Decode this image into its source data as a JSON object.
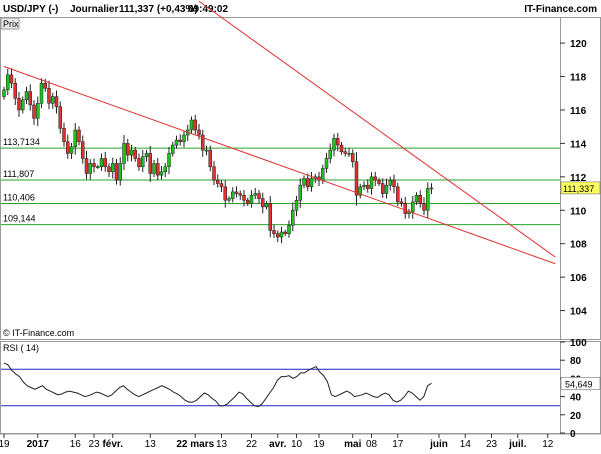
{
  "header": {
    "symbol": "USD/JPY (-)",
    "period": "Journalier",
    "last": "111,337 (+0,43%)",
    "time": "09:49:02",
    "brand": "IT-Finance.com"
  },
  "price_panel": {
    "tab_label": "Prix",
    "watermark": "© IT-Finance.com"
  },
  "rsi_panel": {
    "title": "RSI ( 14)"
  },
  "colors": {
    "up": "#1cc41c",
    "down": "#e03030",
    "wick": "#222222",
    "trendline": "#e03030",
    "hline": "#2aa52a",
    "rsi_line": "#222222",
    "rsi_bounds": "#2020c0",
    "last_price_label_bg": "#ffff60"
  },
  "chart_data": [
    {
      "type": "candlestick",
      "title": "USD/JPY (-)",
      "y_ticks": [
        104,
        106,
        108,
        110,
        112,
        114,
        116,
        118,
        120
      ],
      "ylim": [
        102.3,
        121.5
      ],
      "x_tick_labels": [
        {
          "label": "19",
          "bar": 0
        },
        {
          "label": "2017",
          "bar": 9
        },
        {
          "label": "16",
          "bar": 19
        },
        {
          "label": "23",
          "bar": 24
        },
        {
          "label": "févr.",
          "bar": 29
        },
        {
          "label": "13",
          "bar": 39
        },
        {
          "label": "22 mars",
          "bar": 51
        },
        {
          "label": "13",
          "bar": 58
        },
        {
          "label": "22",
          "bar": 66
        },
        {
          "label": "avr.",
          "bar": 73
        },
        {
          "label": "10",
          "bar": 78
        },
        {
          "label": "19",
          "bar": 84
        },
        {
          "label": "mai",
          "bar": 93
        },
        {
          "label": "08",
          "bar": 98
        },
        {
          "label": "17",
          "bar": 105
        },
        {
          "label": "juin",
          "bar": 116
        },
        {
          "label": "14",
          "bar": 123
        },
        {
          "label": "23",
          "bar": 130
        },
        {
          "label": "juil.",
          "bar": 137
        },
        {
          "label": "12",
          "bar": 145
        }
      ],
      "last_price": 111.337,
      "last_price_label": "111,337",
      "horizontal_levels": [
        {
          "value": 113.7134,
          "label": "113,7134"
        },
        {
          "value": 111.807,
          "label": "111,807"
        },
        {
          "value": 110.406,
          "label": "110,406"
        },
        {
          "value": 109.144,
          "label": "109,144"
        }
      ],
      "trendlines": [
        {
          "from": {
            "bar": 0,
            "price": 118.6
          },
          "to": {
            "bar": 147,
            "price": 106.8
          }
        },
        {
          "from": {
            "bar": 52,
            "price": 122.5
          },
          "to": {
            "bar": 147,
            "price": 107.2
          }
        }
      ],
      "closes": [
        117.2,
        118.1,
        117.6,
        116.7,
        116.0,
        116.6,
        117.1,
        116.3,
        115.5,
        116.4,
        117.6,
        117.3,
        116.4,
        116.8,
        116.2,
        114.9,
        114.1,
        113.4,
        113.8,
        114.8,
        114.1,
        113.1,
        112.2,
        112.8,
        112.6,
        112.6,
        113.1,
        112.6,
        112.3,
        112.8,
        111.8,
        112.8,
        114.0,
        113.3,
        113.6,
        113.1,
        112.6,
        113.2,
        113.4,
        112.2,
        112.8,
        112.1,
        112.3,
        112.6,
        113.4,
        113.9,
        114.2,
        114.1,
        114.5,
        114.8,
        115.4,
        114.8,
        114.5,
        113.6,
        113.6,
        112.6,
        111.8,
        111.6,
        111.4,
        110.6,
        110.7,
        111.1,
        111.0,
        110.9,
        110.6,
        110.4,
        110.9,
        111.0,
        110.7,
        110.2,
        110.4,
        108.8,
        108.6,
        108.4,
        108.7,
        108.6,
        109.1,
        110.0,
        110.6,
        111.5,
        111.9,
        111.4,
        111.9,
        112.0,
        111.8,
        112.5,
        113.1,
        113.6,
        114.3,
        113.9,
        113.5,
        113.4,
        113.4,
        112.9,
        110.9,
        111.4,
        111.5,
        111.3,
        112.0,
        111.8,
        111.6,
        111.0,
        111.5,
        111.8,
        111.4,
        110.5,
        110.4,
        109.8,
        109.9,
        110.5,
        110.9,
        110.4,
        110.0,
        111.3,
        111.337
      ]
    },
    {
      "type": "line",
      "title": "RSI ( 14)",
      "y_ticks": [
        0,
        20,
        40,
        60,
        80,
        100
      ],
      "ylim": [
        0,
        100
      ],
      "reference_lines": [
        70,
        30
      ],
      "last_value": 54.649,
      "last_value_label": "54,649",
      "values": [
        77,
        75,
        69,
        65,
        62,
        56,
        52,
        50,
        48,
        50,
        52,
        48,
        46,
        44,
        42,
        43,
        45,
        46,
        45,
        44,
        42,
        40,
        41,
        43,
        45,
        44,
        42,
        40,
        42,
        46,
        50,
        52,
        48,
        45,
        42,
        40,
        42,
        44,
        46,
        48,
        50,
        52,
        50,
        48,
        45,
        43,
        40,
        36,
        34,
        34,
        36,
        40,
        44,
        42,
        38,
        35,
        30,
        30,
        32,
        36,
        40,
        45,
        43,
        38,
        34,
        30,
        29,
        32,
        38,
        44,
        50,
        58,
        62,
        62,
        63,
        60,
        62,
        66,
        66,
        69,
        71,
        73,
        67,
        63,
        56,
        42,
        40,
        42,
        44,
        46,
        44,
        40,
        41,
        42,
        44,
        42,
        40,
        39,
        42,
        44,
        42,
        36,
        34,
        36,
        40,
        46,
        44,
        40,
        36,
        40,
        52,
        54.649
      ]
    }
  ]
}
